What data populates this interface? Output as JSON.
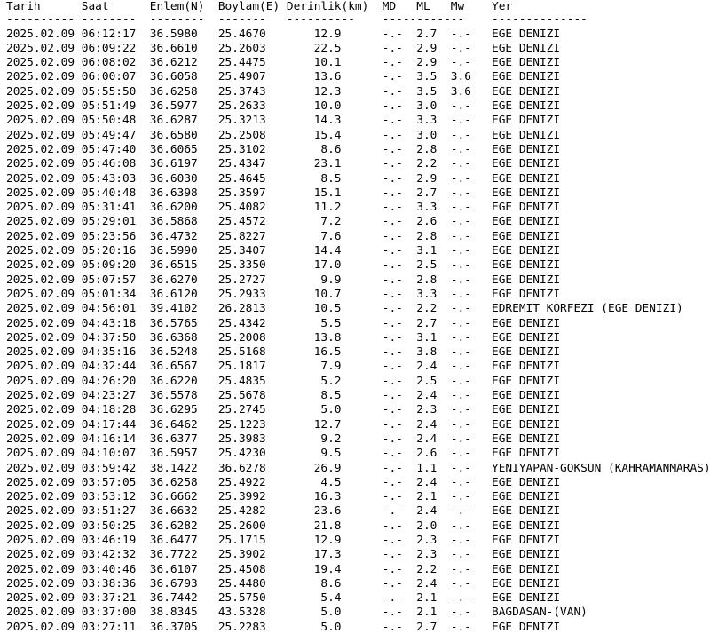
{
  "header": "Tarih      Saat      Enlem(N)  Boylam(E) Derinlik(km)  MD   ML   Mw    Yer",
  "separator": "---------- --------  --------  -------   ----------    ------------    --------------",
  "rows": [
    "2025.02.09 06:12:17  36.5980   25.4670       12.9      -.-  2.7  -.-   EGE DENIZI",
    "2025.02.09 06:09:22  36.6610   25.2603       22.5      -.-  2.9  -.-   EGE DENIZI",
    "2025.02.09 06:08:02  36.6212   25.4475       10.1      -.-  2.9  -.-   EGE DENIZI",
    "2025.02.09 06:00:07  36.6058   25.4907       13.6      -.-  3.5  3.6   EGE DENIZI",
    "2025.02.09 05:55:50  36.6258   25.3743       12.3      -.-  3.5  3.6   EGE DENIZI",
    "2025.02.09 05:51:49  36.5977   25.2633       10.0      -.-  3.0  -.-   EGE DENIZI",
    "2025.02.09 05:50:48  36.6287   25.3213       14.3      -.-  3.3  -.-   EGE DENIZI",
    "2025.02.09 05:49:47  36.6580   25.2508       15.4      -.-  3.0  -.-   EGE DENIZI",
    "2025.02.09 05:47:40  36.6065   25.3102        8.6      -.-  2.8  -.-   EGE DENIZI",
    "2025.02.09 05:46:08  36.6197   25.4347       23.1      -.-  2.2  -.-   EGE DENIZI",
    "2025.02.09 05:43:03  36.6030   25.4645        8.5      -.-  2.9  -.-   EGE DENIZI",
    "2025.02.09 05:40:48  36.6398   25.3597       15.1      -.-  2.7  -.-   EGE DENIZI",
    "2025.02.09 05:31:41  36.6200   25.4082       11.2      -.-  3.3  -.-   EGE DENIZI",
    "2025.02.09 05:29:01  36.5868   25.4572        7.2      -.-  2.6  -.-   EGE DENIZI",
    "2025.02.09 05:23:56  36.4732   25.8227        7.6      -.-  2.8  -.-   EGE DENIZI",
    "2025.02.09 05:20:16  36.5990   25.3407       14.4      -.-  3.1  -.-   EGE DENIZI",
    "2025.02.09 05:09:20  36.6515   25.3350       17.0      -.-  2.5  -.-   EGE DENIZI",
    "2025.02.09 05:07:57  36.6270   25.2727        9.9      -.-  2.8  -.-   EGE DENIZI",
    "2025.02.09 05:01:34  36.6120   25.2933       10.7      -.-  3.3  -.-   EGE DENIZI",
    "2025.02.09 04:56:01  39.4102   26.2813       10.5      -.-  2.2  -.-   EDREMIT KORFEZI (EGE DENIZI)",
    "2025.02.09 04:43:18  36.5765   25.4342        5.5      -.-  2.7  -.-   EGE DENIZI",
    "2025.02.09 04:37:50  36.6368   25.2008       13.8      -.-  3.1  -.-   EGE DENIZI",
    "2025.02.09 04:35:16  36.5248   25.5168       16.5      -.-  3.8  -.-   EGE DENIZI",
    "2025.02.09 04:32:44  36.6567   25.1817        7.9      -.-  2.4  -.-   EGE DENIZI",
    "2025.02.09 04:26:20  36.6220   25.4835        5.2      -.-  2.5  -.-   EGE DENIZI",
    "2025.02.09 04:23:27  36.5578   25.5678        8.5      -.-  2.4  -.-   EGE DENIZI",
    "2025.02.09 04:18:28  36.6295   25.2745        5.0      -.-  2.3  -.-   EGE DENIZI",
    "2025.02.09 04:17:44  36.6462   25.1223       12.7      -.-  2.4  -.-   EGE DENIZI",
    "2025.02.09 04:16:14  36.6377   25.3983        9.2      -.-  2.4  -.-   EGE DENIZI",
    "2025.02.09 04:10:07  36.5957   25.4230        9.5      -.-  2.6  -.-   EGE DENIZI",
    "2025.02.09 03:59:42  38.1422   36.6278       26.9      -.-  1.1  -.-   YENIYAPAN-GOKSUN (KAHRAMANMARAS)",
    "2025.02.09 03:57:05  36.6258   25.4922        4.5      -.-  2.4  -.-   EGE DENIZI",
    "2025.02.09 03:53:12  36.6662   25.3992       16.3      -.-  2.1  -.-   EGE DENIZI",
    "2025.02.09 03:51:27  36.6632   25.4282       23.6      -.-  2.4  -.-   EGE DENIZI",
    "2025.02.09 03:50:25  36.6282   25.2600       21.8      -.-  2.0  -.-   EGE DENIZI",
    "2025.02.09 03:46:19  36.6477   25.1715       12.9      -.-  2.3  -.-   EGE DENIZI",
    "2025.02.09 03:42:32  36.7722   25.3902       17.3      -.-  2.3  -.-   EGE DENIZI",
    "2025.02.09 03:40:46  36.6107   25.4508       19.4      -.-  2.2  -.-   EGE DENIZI",
    "2025.02.09 03:38:36  36.6793   25.4480        8.6      -.-  2.4  -.-   EGE DENIZI",
    "2025.02.09 03:37:21  36.7442   25.5750        5.4      -.-  2.1  -.-   EGE DENIZI",
    "2025.02.09 03:37:00  38.8345   43.5328        5.0      -.-  2.1  -.-   BAGDASAN-(VAN)",
    "2025.02.09 03:27:11  36.3705   25.2283        5.0      -.-  2.7  -.-   EGE DENIZI"
  ]
}
